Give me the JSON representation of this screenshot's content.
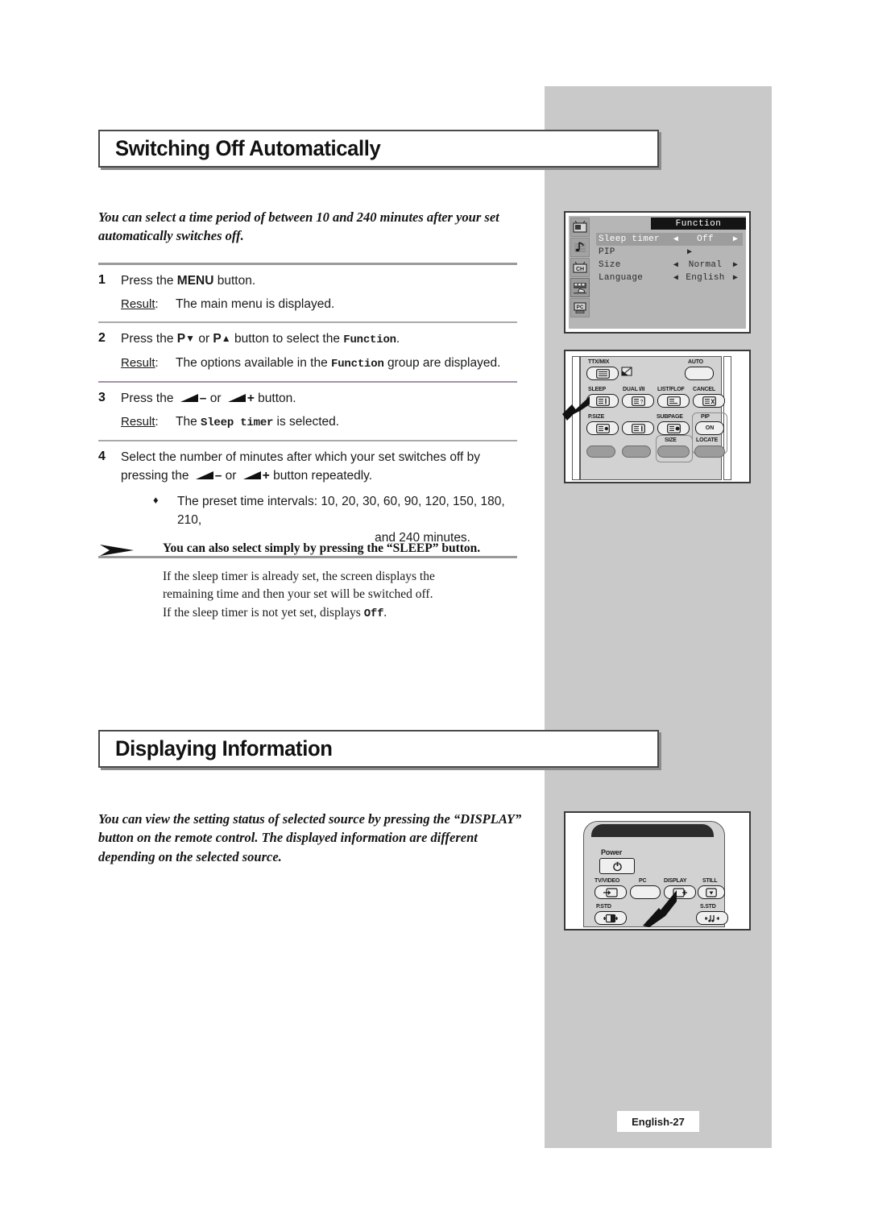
{
  "page": {
    "footer_label": "English-27"
  },
  "sections": [
    {
      "title": "Switching Off Automatically",
      "intro": "You can select a time period of between 10 and 240 minutes after your set automatically switches off."
    },
    {
      "title": "Displaying Information",
      "intro": "You can view the setting status of selected source by pressing the “DISPLAY” button on the remote control. The displayed information are different depending on the selected source."
    }
  ],
  "steps": [
    {
      "number": "1",
      "instruction_pre": "Press the ",
      "instruction_key": "MENU",
      "instruction_post": " button.",
      "result_label": "Result",
      "result_text": "The main menu is displayed."
    },
    {
      "number": "2",
      "instruction_pre": "Press the ",
      "key_a": "P",
      "instruction_mid": " or ",
      "key_b": "P",
      "instruction_post": " button to select the ",
      "mono_term": "Function",
      "instruction_end": ".",
      "result_label": "Result",
      "result_pre": "The options available in the ",
      "result_mono": "Function",
      "result_post": " group are displayed."
    },
    {
      "number": "3",
      "instruction_pre": "Press the ",
      "minus": "–",
      "instruction_mid": " or ",
      "plus": "+",
      "instruction_post": " button.",
      "result_label": "Result",
      "result_pre": "The ",
      "result_mono": "Sleep timer",
      "result_post": " is selected."
    },
    {
      "number": "4",
      "instruction_pre": "Select the number of minutes after which your set  switches off by pressing the ",
      "minus": "–",
      "instruction_mid": " or ",
      "plus": "+",
      "instruction_post": " button repeatedly.",
      "bullet_marker": "♦",
      "bullet_text": "The preset time intervals: 10, 20, 30, 60, 90, 120, 150, 180, 210,",
      "bullet_text_2": "and 240 minutes."
    }
  ],
  "note": {
    "arrow_icon": "arrow-right-icon",
    "heading": "You can also select simply by pressing the “SLEEP” button.",
    "line1": "If the sleep timer is already set, the screen displays the",
    "line2": "remaining time and then your set will be switched off.",
    "line3_pre": "If the sleep timer is not yet set, displays ",
    "line3_mono": "Off",
    "line3_post": "."
  },
  "osd": {
    "header_title": "Function",
    "sidebar_icons": [
      {
        "name": "picture-icon",
        "label": ""
      },
      {
        "name": "sound-icon",
        "label": ""
      },
      {
        "name": "channel-icon",
        "label": "CH"
      },
      {
        "name": "function-icon",
        "label": ""
      },
      {
        "name": "pc-icon",
        "label": "PC"
      }
    ],
    "rows": [
      {
        "label": "Sleep timer",
        "left_arrow": "◀",
        "value": "Off",
        "right_arrow": "▶",
        "selected": true
      },
      {
        "label": "PIP",
        "left_arrow": "",
        "value": "▶",
        "right_arrow": "",
        "selected": false
      },
      {
        "label": "Size",
        "left_arrow": "◀",
        "value": "Normal",
        "right_arrow": "▶",
        "selected": false
      },
      {
        "label": "Language",
        "left_arrow": "◀",
        "value": "English",
        "right_arrow": "▶",
        "selected": false
      }
    ]
  },
  "remote_top": {
    "buttons": [
      {
        "name": "ttx-mix-button",
        "label": "TTX/MIX"
      },
      {
        "name": "auto-button",
        "label": "AUTO"
      },
      {
        "name": "sleep-button",
        "label": "SLEEP"
      },
      {
        "name": "dual-button",
        "label": "DUAL I/II"
      },
      {
        "name": "list-flof-button",
        "label": "LIST/FLOF"
      },
      {
        "name": "cancel-button",
        "label": "CANCEL"
      },
      {
        "name": "p-size-button",
        "label": "P.SIZE"
      },
      {
        "name": "subpage-button",
        "label": "SUBPAGE"
      },
      {
        "name": "pip-button",
        "label": "PIP"
      },
      {
        "name": "pip-on-button",
        "label": "ON"
      },
      {
        "name": "size-button",
        "label": "SIZE"
      },
      {
        "name": "locate-button",
        "label": "LOCATE"
      }
    ]
  },
  "remote_bottom": {
    "buttons": [
      {
        "name": "power-button",
        "label": "Power"
      },
      {
        "name": "tv-video-button",
        "label": "TV/VIDEO"
      },
      {
        "name": "pc-button",
        "label": "PC"
      },
      {
        "name": "display-button",
        "label": "DISPLAY"
      },
      {
        "name": "still-button",
        "label": "STILL"
      },
      {
        "name": "p-std-button",
        "label": "P.STD"
      },
      {
        "name": "s-std-button",
        "label": "S.STD"
      }
    ]
  }
}
